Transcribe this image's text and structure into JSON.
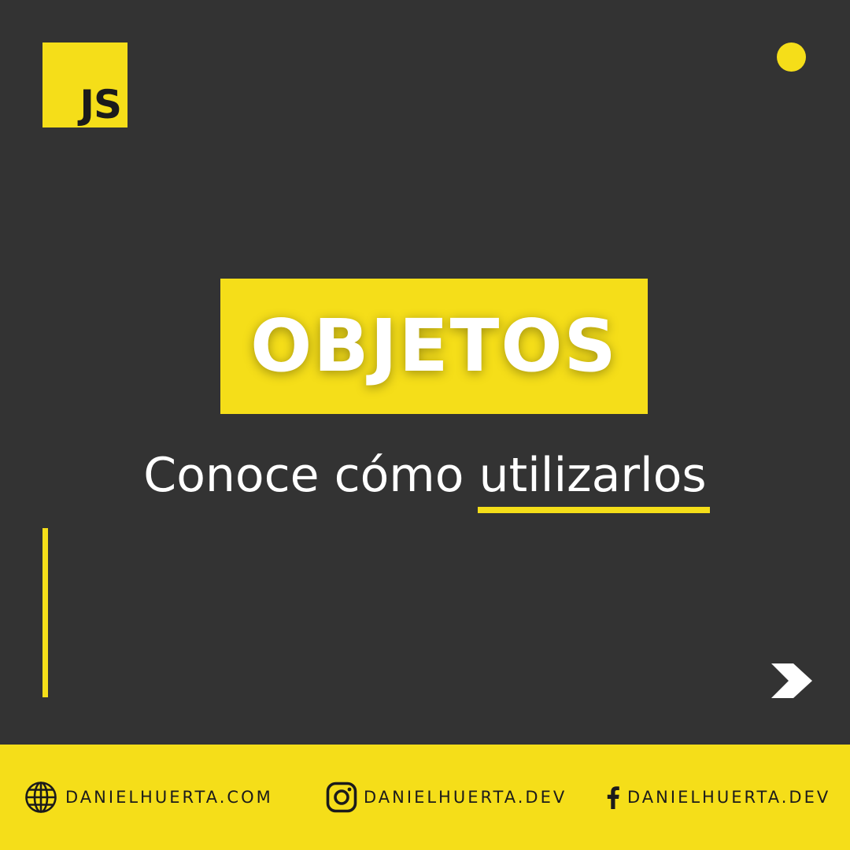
{
  "logo": {
    "text": "JS"
  },
  "title": "OBJETOS",
  "subtitle": {
    "prefix": "Conoce cómo",
    "highlight": "utilizarlos"
  },
  "footer": {
    "website": {
      "icon": "globe-icon",
      "label": "DANIELHUERTA.COM"
    },
    "instagram": {
      "icon": "instagram-icon",
      "label": "DANIELHUERTA.DEV"
    },
    "facebook": {
      "icon": "facebook-icon",
      "label": "DANIELHUERTA.DEV"
    }
  },
  "colors": {
    "background": "#333333",
    "accent": "#F5DE19",
    "text_light": "#FFFFFF",
    "text_dark": "#1B1B1B"
  }
}
